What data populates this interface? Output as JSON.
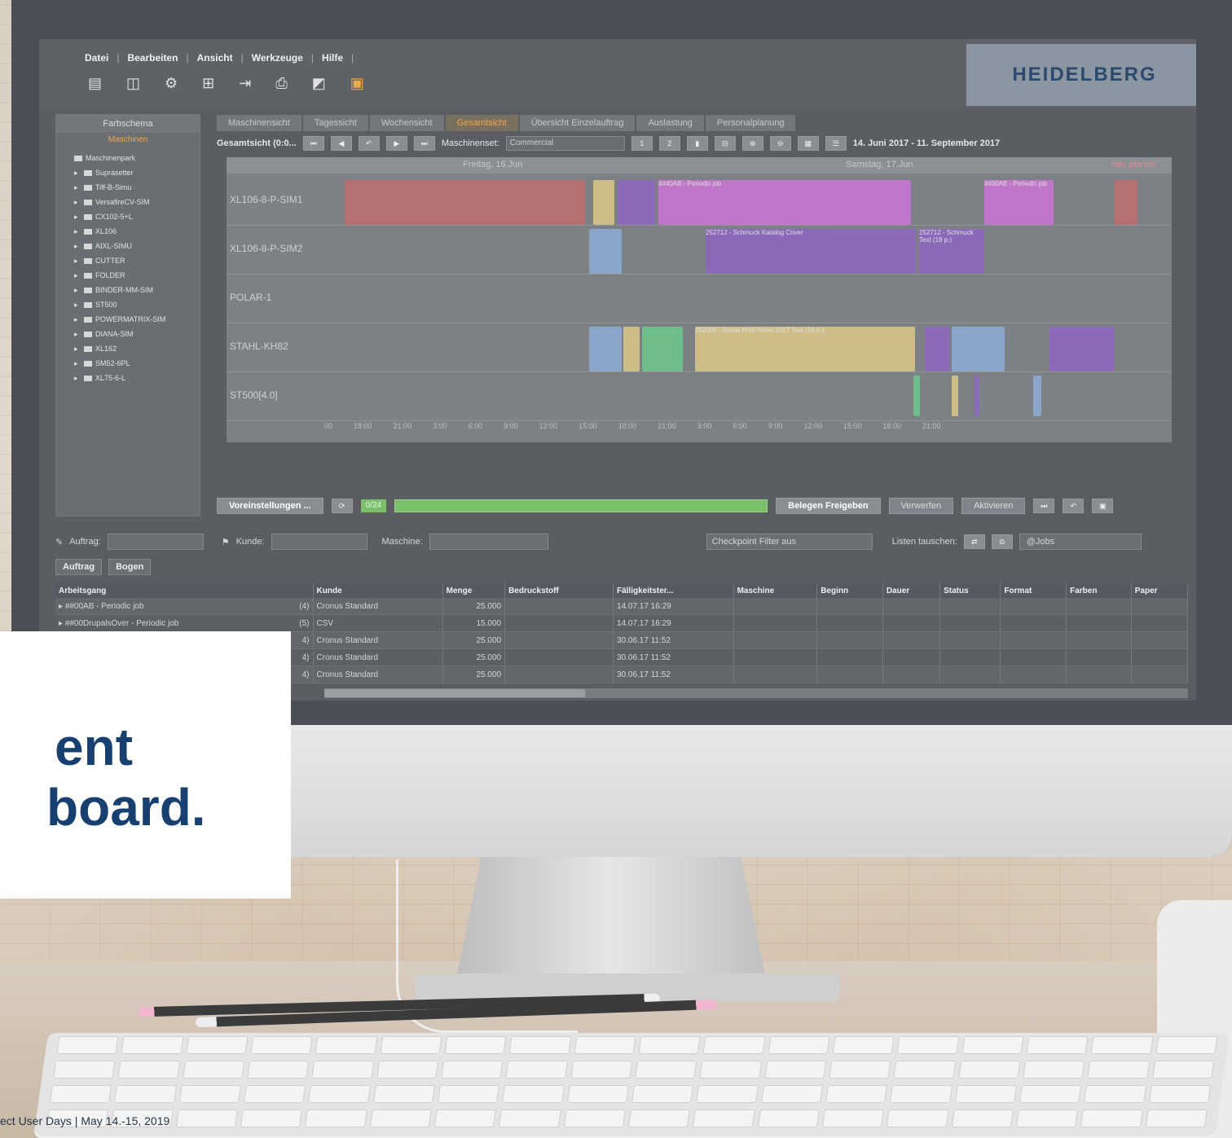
{
  "app": {
    "menu": [
      "Datei",
      "Bearbeiten",
      "Ansicht",
      "Werkzeuge",
      "Hilfe"
    ],
    "logo": "HEIDELBERG",
    "toolbar_icons": [
      "file-icon",
      "clipboard-icon",
      "settings-file-icon",
      "tree-icon",
      "export-icon",
      "print-icon",
      "chart-icon",
      "folder-icon"
    ]
  },
  "left_panel": {
    "title": "Farbschema",
    "subtitle": "Maschinen",
    "root": "Maschinenpark",
    "items": [
      "Suprasetter",
      "Tiff-B-Simu",
      "VersafireCV-SIM",
      "CX102-5+L",
      "XL106",
      "AIXL-SIMU",
      "CUTTER",
      "FOLDER",
      "BINDER-MM-SIM",
      "ST500",
      "POWERMATRIX-SIM",
      "DIANA-SIM",
      "XL162",
      "SM52-6PL",
      "XL75-6-L"
    ]
  },
  "tabs": [
    "Maschinensicht",
    "Tagessicht",
    "Wochensicht",
    "Gesamtsicht",
    "Übersicht Einzelauftrag",
    "Auslastung",
    "Personalplanung"
  ],
  "active_tab": "Gesamtsicht",
  "controls": {
    "view_label": "Gesamtsicht  (0:0...",
    "machineset_label": "Maschinenset:",
    "machineset_value": "Commercial",
    "page_1": "1",
    "page_2": "2",
    "date_range": "14. Juni 2017  -  11. September 2017"
  },
  "gantt": {
    "day1": "Freitag, 16.Jun",
    "day2": "Samstag, 17.Jun",
    "right_header": "neu planen",
    "rows": [
      "XL106-8-P-SIM1",
      "XL106-8-P-SIM2",
      "POLAR-1",
      "STAHL-KH82",
      "ST500[4.0]"
    ],
    "time_ticks": [
      "00",
      "18:00",
      "21:00",
      "3:00",
      "6:00",
      "9:00",
      "12:00",
      "15:00",
      "18:00",
      "21:00",
      "3:00",
      "6:00",
      "9:00",
      "12:00",
      "15:00",
      "18:00",
      "21:00"
    ],
    "bar_labels": [
      "##40AB - Periodic job",
      "##30AE - Periodic job",
      "252712 - Schmuck Katalog Cover",
      "252712 - Schmuck Text (18 p.)",
      "252000 - Street Print Show 2017 Text (16 p.)"
    ]
  },
  "bottom_controls": {
    "settings": "Voreinstellungen ...",
    "count": "0/24",
    "release": "Belegen Freigeben",
    "discard": "Verwerfen",
    "activate": "Aktivieren"
  },
  "filters": {
    "order_label": "Auftrag:",
    "customer_label": "Kunde:",
    "machine_label": "Maschine:",
    "checkpoint": "Checkpoint Filter aus",
    "swap_label": "Listen tauschen:",
    "jobs_select": "@Jobs"
  },
  "grouping": [
    "Auftrag",
    "Bogen"
  ],
  "table": {
    "columns": [
      "Arbeitsgang",
      "Kunde",
      "Menge",
      "Bedruckstoff",
      "Fälligkeitster...",
      "Maschine",
      "Beginn",
      "Dauer",
      "Status",
      "Format",
      "Farben",
      "Paper"
    ],
    "rows": [
      {
        "job": "##00AB - Periodic job",
        "n": "(4)",
        "kunde": "Cronus Standard",
        "menge": "25.000",
        "faellig": "14.07.17 16:29"
      },
      {
        "job": "##00DrupalsOver - Periodic job",
        "n": "(5)",
        "kunde": "CSV",
        "menge": "15.000",
        "faellig": "14.07.17 16:29"
      },
      {
        "job": "",
        "n": "4)",
        "kunde": "Cronus Standard",
        "menge": "25.000",
        "faellig": "30.06.17 11:52"
      },
      {
        "job": "",
        "n": "4)",
        "kunde": "Cronus Standard",
        "menge": "25.000",
        "faellig": "30.06.17 11:52"
      },
      {
        "job": "",
        "n": "4)",
        "kunde": "Cronus Standard",
        "menge": "25.000",
        "faellig": "30.06.17 11:52"
      }
    ]
  },
  "overlay": {
    "headline_line1": "ent",
    "headline_line2": "board.",
    "footer": "ect User Days | May 14.-15, 2019"
  },
  "colors": {
    "headline": "#173f70",
    "accent_orange": "#f0a94a",
    "progress_green": "#7bbf6a"
  }
}
